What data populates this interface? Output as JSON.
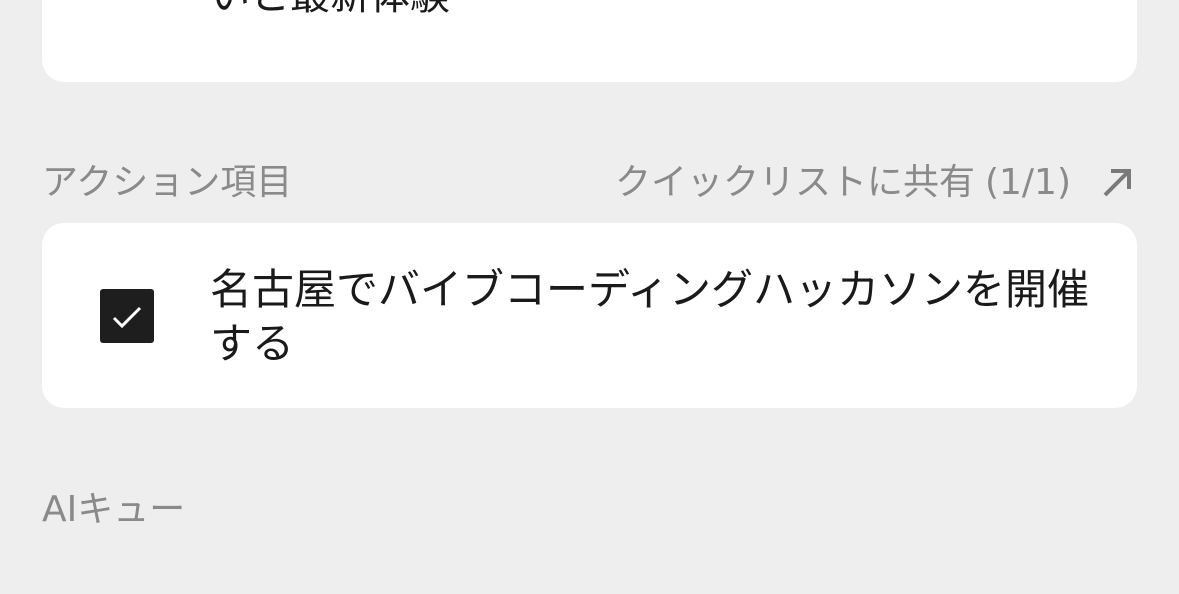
{
  "top_card": {
    "clipped_text": "いと最新体験"
  },
  "action_section": {
    "title": "アクション項目",
    "share_label": "クイックリストに共有",
    "share_count": "(1/1)",
    "share_icon": "arrow-up-right-icon"
  },
  "action_items": [
    {
      "checked": true,
      "text": "名古屋でバイブコーディングハッカソンを開催する"
    }
  ],
  "ai_section": {
    "title": "AIキュー"
  },
  "colors": {
    "background": "#eeeeee",
    "card": "#ffffff",
    "muted_text": "#8a8a8a",
    "body_text": "#1a1a1a",
    "checkbox_fill": "#1e1e1e"
  }
}
